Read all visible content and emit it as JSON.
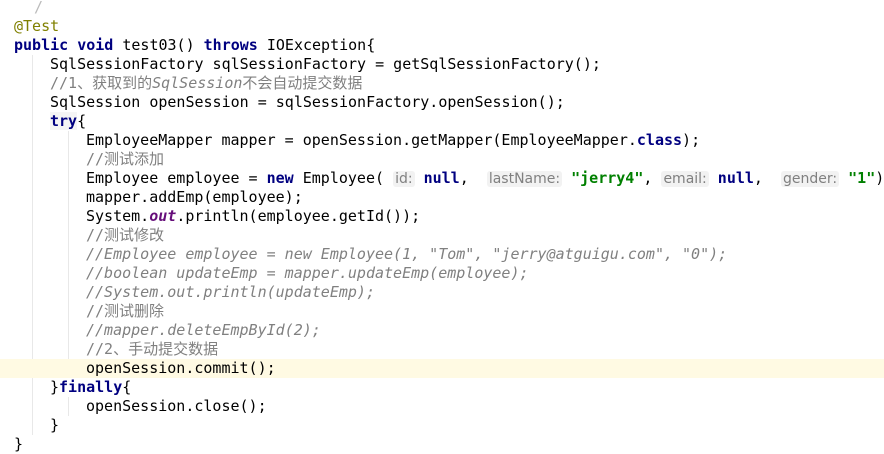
{
  "editor": {
    "lines": [
      {
        "name": "line-fold-top",
        "indent": 0,
        "tokens": [
          {
            "t": "/",
            "c": "fold-mark"
          }
        ]
      },
      {
        "name": "line-annotation",
        "indent": 0,
        "tokens": [
          {
            "t": "@Test",
            "c": "ann"
          }
        ]
      },
      {
        "name": "line-method-signature",
        "indent": 0,
        "tokens": [
          {
            "t": "public ",
            "c": "kw"
          },
          {
            "t": "void ",
            "c": "kw"
          },
          {
            "t": "test03() ",
            "c": ""
          },
          {
            "t": "throws ",
            "c": "kw"
          },
          {
            "t": "IOException{",
            "c": ""
          }
        ]
      },
      {
        "name": "line-factory",
        "indent": 1,
        "tokens": [
          {
            "t": "SqlSessionFactory sqlSessionFactory = getSqlSessionFactory();",
            "c": ""
          }
        ]
      },
      {
        "name": "line-comment-1",
        "indent": 1,
        "tokens": [
          {
            "t": "//1、获取到的",
            "c": "cmt-cn"
          },
          {
            "t": "SqlSession",
            "c": "cmt"
          },
          {
            "t": "不会自动提交数据",
            "c": "cmt-cn"
          }
        ]
      },
      {
        "name": "line-open-session",
        "indent": 1,
        "tokens": [
          {
            "t": "SqlSession openSession = sqlSessionFactory.openSession();",
            "c": ""
          }
        ]
      },
      {
        "name": "line-try",
        "indent": 1,
        "tokens": [
          {
            "t": "try",
            "c": "kw brace-match"
          },
          {
            "t": "{",
            "c": ""
          }
        ]
      },
      {
        "name": "line-get-mapper",
        "indent": 2,
        "tokens": [
          {
            "t": "EmployeeMapper mapper = openSession.getMapper(EmployeeMapper.",
            "c": ""
          },
          {
            "t": "class",
            "c": "kw"
          },
          {
            "t": ");",
            "c": ""
          }
        ]
      },
      {
        "name": "line-comment-add",
        "indent": 2,
        "tokens": [
          {
            "t": "//测试添加",
            "c": "cmt-cn"
          }
        ]
      },
      {
        "name": "line-new-employee",
        "indent": 2,
        "tokens": [
          {
            "t": "Employee employee = ",
            "c": ""
          },
          {
            "t": "new ",
            "c": "kw"
          },
          {
            "t": "Employee( ",
            "c": ""
          },
          {
            "t": "id:",
            "c": "hint"
          },
          {
            "t": " ",
            "c": ""
          },
          {
            "t": "null",
            "c": "kw"
          },
          {
            "t": ",  ",
            "c": ""
          },
          {
            "t": "lastName:",
            "c": "hint"
          },
          {
            "t": " ",
            "c": ""
          },
          {
            "t": "\"jerry4\"",
            "c": "str"
          },
          {
            "t": ", ",
            "c": ""
          },
          {
            "t": "email:",
            "c": "hint"
          },
          {
            "t": " ",
            "c": ""
          },
          {
            "t": "null",
            "c": "kw"
          },
          {
            "t": ",  ",
            "c": ""
          },
          {
            "t": "gender:",
            "c": "hint"
          },
          {
            "t": " ",
            "c": ""
          },
          {
            "t": "\"1\"",
            "c": "str"
          },
          {
            "t": ");",
            "c": ""
          }
        ]
      },
      {
        "name": "line-add-emp",
        "indent": 2,
        "tokens": [
          {
            "t": "mapper.addEmp(employee);",
            "c": ""
          }
        ]
      },
      {
        "name": "line-println-id",
        "indent": 2,
        "tokens": [
          {
            "t": "System.",
            "c": ""
          },
          {
            "t": "out",
            "c": "field"
          },
          {
            "t": ".println(employee.getId());",
            "c": ""
          }
        ]
      },
      {
        "name": "line-comment-update",
        "indent": 2,
        "tokens": [
          {
            "t": "//测试修改",
            "c": "cmt-cn"
          }
        ]
      },
      {
        "name": "line-commented-employee",
        "indent": 2,
        "tokens": [
          {
            "t": "//Employee employee = new Employee(1, \"Tom\", \"jerry@atguigu.com\", \"0\");",
            "c": "cmt"
          }
        ]
      },
      {
        "name": "line-commented-update",
        "indent": 2,
        "tokens": [
          {
            "t": "//boolean updateEmp = mapper.updateEmp(employee);",
            "c": "cmt"
          }
        ]
      },
      {
        "name": "line-commented-println",
        "indent": 2,
        "tokens": [
          {
            "t": "//System.out.println(updateEmp);",
            "c": "cmt"
          }
        ]
      },
      {
        "name": "line-comment-delete",
        "indent": 2,
        "tokens": [
          {
            "t": "//测试删除",
            "c": "cmt-cn"
          }
        ]
      },
      {
        "name": "line-commented-delete",
        "indent": 2,
        "tokens": [
          {
            "t": "//mapper.deleteEmpById(2);",
            "c": "cmt"
          }
        ]
      },
      {
        "name": "line-comment-2",
        "indent": 2,
        "tokens": [
          {
            "t": "//2、手动提交数据",
            "c": "cmt-cn"
          }
        ]
      },
      {
        "name": "line-commit",
        "indent": 2,
        "current": true,
        "tokens": [
          {
            "t": "openSession.commit();",
            "c": ""
          }
        ]
      },
      {
        "name": "line-finally",
        "indent": 1,
        "tokens": [
          {
            "t": "}",
            "c": ""
          },
          {
            "t": "finally",
            "c": "kw"
          },
          {
            "t": "{",
            "c": ""
          }
        ]
      },
      {
        "name": "line-close",
        "indent": 2,
        "tokens": [
          {
            "t": "openSession.close();",
            "c": ""
          }
        ]
      },
      {
        "name": "line-close-brace-inner",
        "indent": 1,
        "tokens": [
          {
            "t": "}",
            "c": ""
          }
        ]
      },
      {
        "name": "line-close-brace-outer",
        "indent": 0,
        "tokens": [
          {
            "t": "}",
            "c": ""
          }
        ]
      }
    ]
  }
}
